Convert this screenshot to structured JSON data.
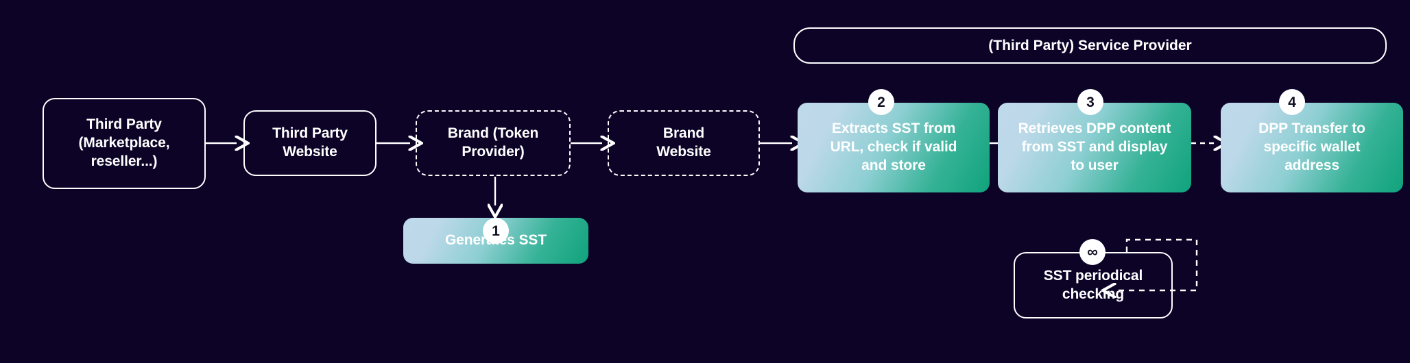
{
  "background_color": "#0d0327",
  "accent_gradient": {
    "from": "#bfd9ea",
    "to": "#10a37c"
  },
  "banner": {
    "label": "(Third Party) Service Provider"
  },
  "nodes": {
    "third_party": {
      "line1": "Third Party",
      "line2": "(Marketplace,",
      "line3": "reseller...)"
    },
    "third_party_website": {
      "line1": "Third Party",
      "line2": "Website"
    },
    "brand_token_provider": {
      "line1": "Brand (Token",
      "line2": "Provider)"
    },
    "brand_website": {
      "line1": "Brand",
      "line2": "Website"
    },
    "generates_sst": {
      "line1": "Generates SST"
    },
    "extracts_sst": {
      "line1": "Extracts SST from",
      "line2": "URL, check if valid",
      "line3": "and store"
    },
    "retrieves_dpp": {
      "line1": "Retrieves DPP content",
      "line2": "from SST and display",
      "line3": "to user"
    },
    "dpp_transfer": {
      "line1": "DPP Transfer to",
      "line2": "specific wallet",
      "line3": "address"
    },
    "sst_periodical": {
      "line1": "SST periodical",
      "line2": "checking"
    }
  },
  "badges": {
    "step1": "1",
    "step2": "2",
    "step3": "3",
    "step4": "4",
    "loop": "∞"
  }
}
